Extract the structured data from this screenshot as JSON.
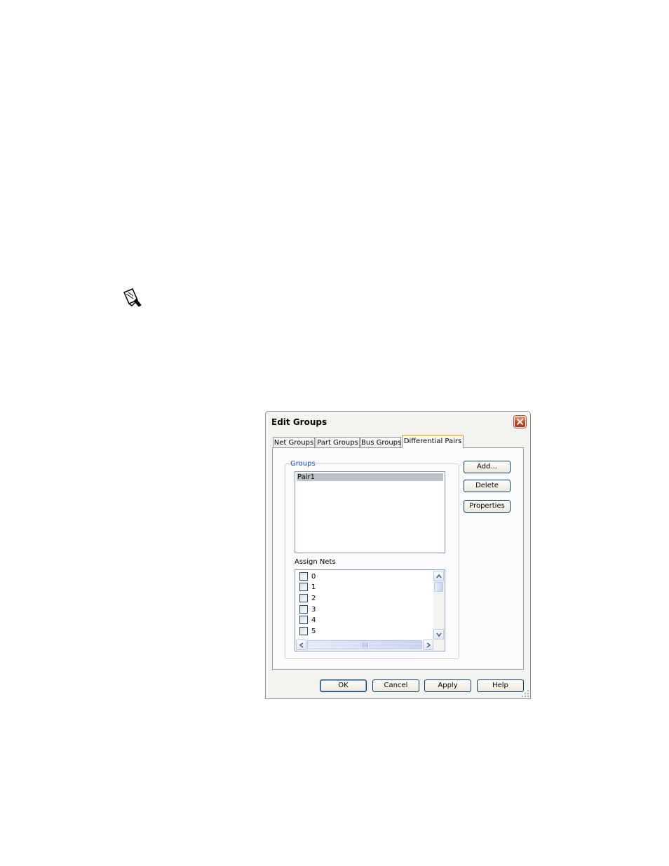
{
  "dialog": {
    "title": "Edit Groups",
    "close_label": "×"
  },
  "tabs": [
    {
      "label": "Net Groups",
      "active": false
    },
    {
      "label": "Part Groups",
      "active": false
    },
    {
      "label": "Bus Groups",
      "active": false
    },
    {
      "label": "Differential Pairs",
      "active": true
    }
  ],
  "groups": {
    "label": "Groups",
    "items": [
      "Pair1"
    ],
    "selected": "Pair1"
  },
  "assign_nets": {
    "label": "Assign Nets",
    "items": [
      "0",
      "1",
      "2",
      "3",
      "4",
      "5"
    ]
  },
  "side_buttons": {
    "add": "Add...",
    "delete": "Delete",
    "properties": "Properties"
  },
  "footer_buttons": {
    "ok": "OK",
    "cancel": "Cancel",
    "apply": "Apply",
    "help": "Help"
  },
  "colors": {
    "tab_highlight": "#ffc83c",
    "close_button": "#c5451f",
    "selection": "#c0c0c8",
    "group_label": "#0046d5"
  },
  "icons": {
    "note": "note-pencil-icon",
    "close": "close-icon"
  }
}
